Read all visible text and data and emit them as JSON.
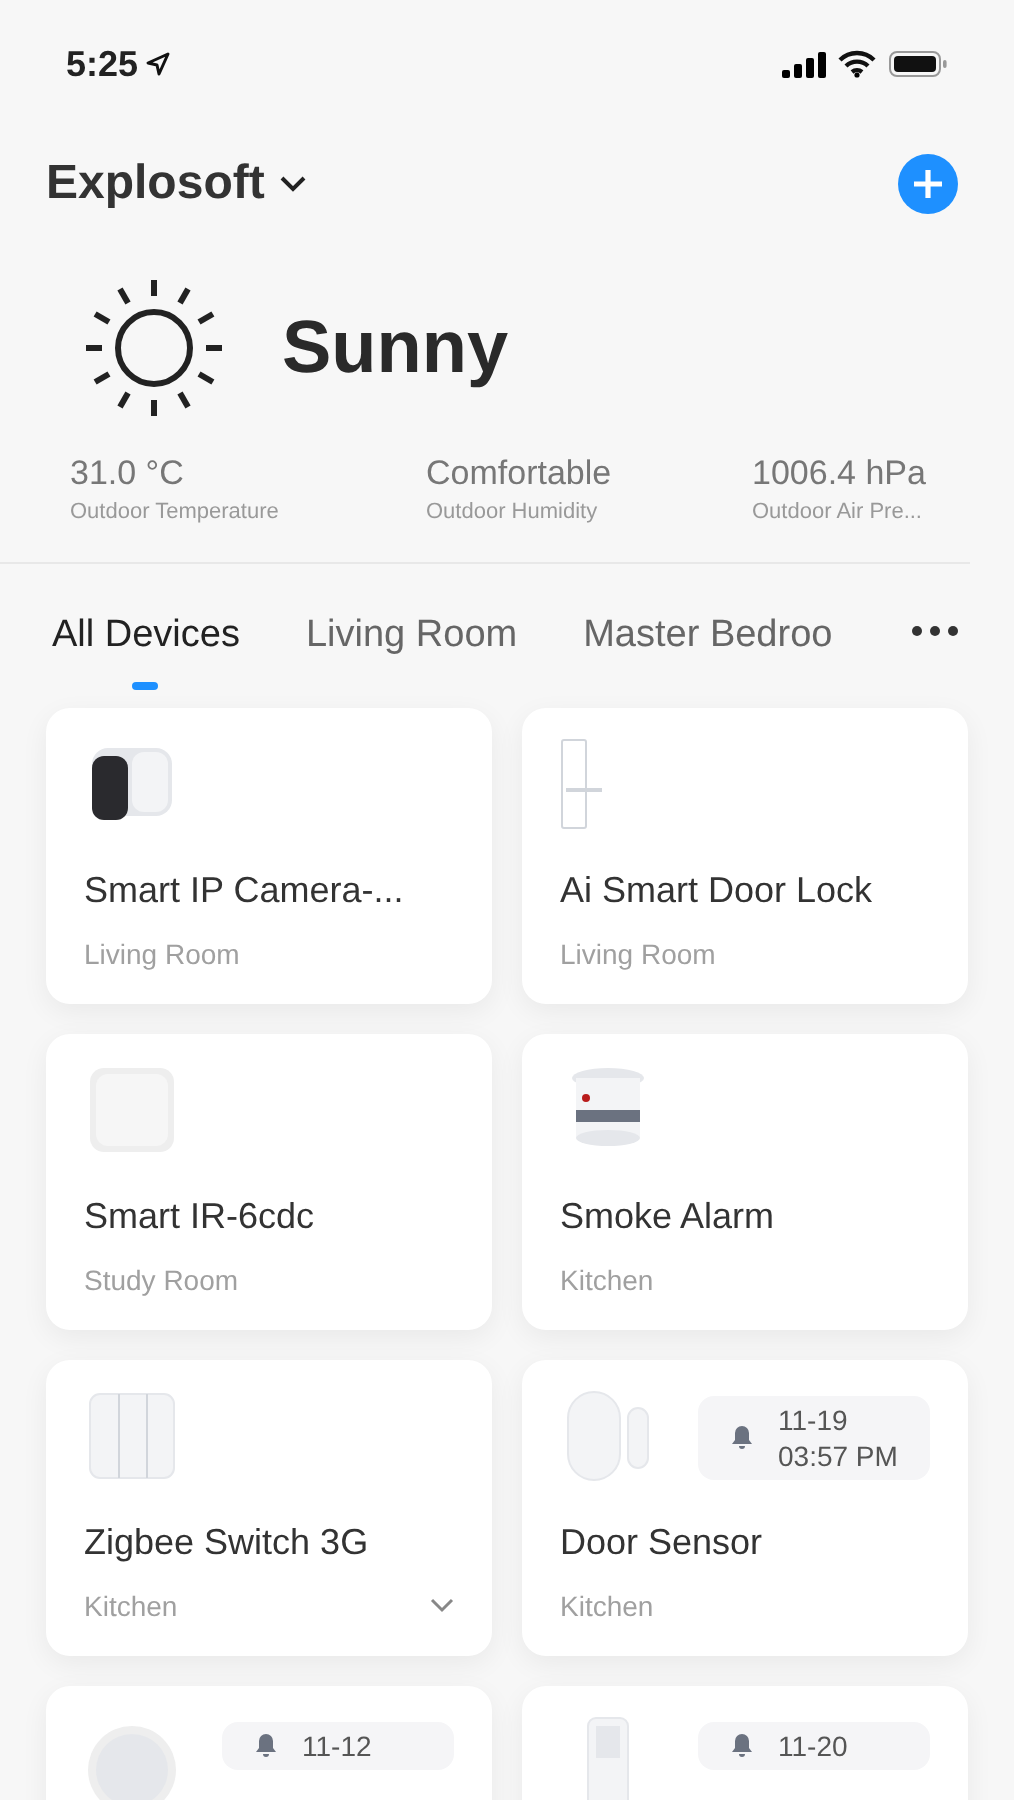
{
  "status_bar": {
    "time": "5:25"
  },
  "header": {
    "home": "Explosoft"
  },
  "weather": {
    "condition": "Sunny",
    "stats": [
      {
        "value": "31.0 °C",
        "label": "Outdoor Temperature"
      },
      {
        "value": "Comfortable",
        "label": "Outdoor Humidity"
      },
      {
        "value": "1006.4 hPa",
        "label": "Outdoor Air Pre..."
      }
    ]
  },
  "tabs": [
    {
      "label": "All Devices",
      "selected": true
    },
    {
      "label": "Living Room",
      "selected": false
    },
    {
      "label": "Master Bedroo",
      "selected": false
    }
  ],
  "devices": [
    {
      "kind": "camera",
      "name": "Smart IP Camera-...",
      "room": "Living Room",
      "expandable": false
    },
    {
      "kind": "lock",
      "name": "Ai Smart Door Lock",
      "room": "Living Room",
      "expandable": false
    },
    {
      "kind": "hub",
      "name": "Smart IR-6cdc",
      "room": "Study Room",
      "expandable": false
    },
    {
      "kind": "smoke",
      "name": "Smoke Alarm",
      "room": "Kitchen",
      "expandable": false
    },
    {
      "kind": "switch",
      "name": "Zigbee Switch 3G",
      "room": "Kitchen",
      "expandable": true
    },
    {
      "kind": "contact",
      "name": "Door Sensor",
      "room": "Kitchen",
      "expandable": false,
      "alert": {
        "date": "11-19",
        "time": "03:57 PM"
      }
    },
    {
      "kind": "sos",
      "alert": {
        "date": "11-12"
      }
    },
    {
      "kind": "pir",
      "alert": {
        "date": "11-20"
      }
    }
  ]
}
